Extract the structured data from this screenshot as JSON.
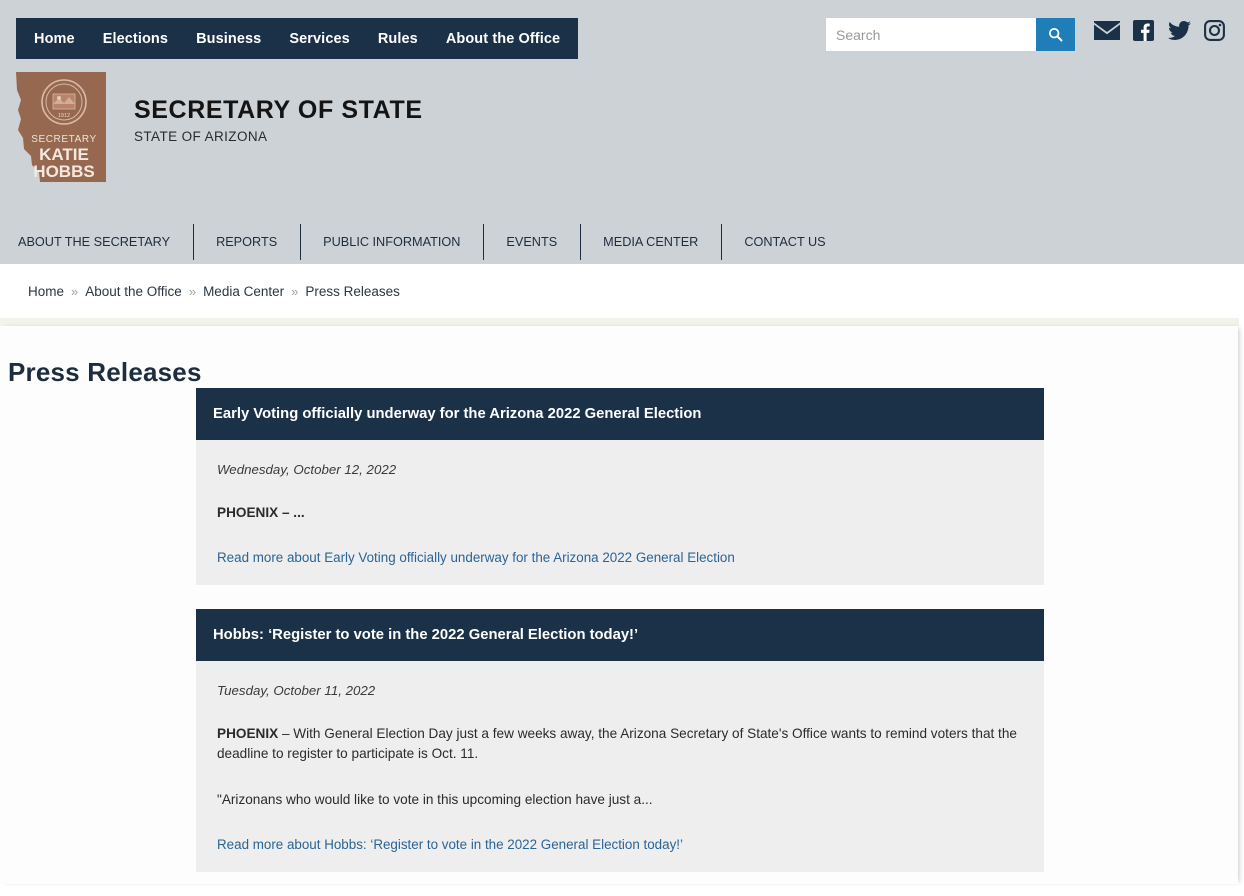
{
  "colors": {
    "navy": "#1a3147",
    "header_gray": "#cdd2d6",
    "accent_blue": "#1f7eb8",
    "link_blue": "#2a6496",
    "card_body_gray": "#eeeeee",
    "cream": "#f3f2eb",
    "logo_brown": "#96684f"
  },
  "main_nav": {
    "items": [
      {
        "label": "Home"
      },
      {
        "label": "Elections"
      },
      {
        "label": "Business"
      },
      {
        "label": "Services"
      },
      {
        "label": "Rules"
      },
      {
        "label": "About the Office"
      }
    ]
  },
  "search": {
    "value": "",
    "placeholder": "Search",
    "button_icon": "search-icon"
  },
  "social": [
    {
      "name": "email-icon",
      "label": "Email"
    },
    {
      "name": "facebook-icon",
      "label": "Facebook"
    },
    {
      "name": "twitter-icon",
      "label": "Twitter"
    },
    {
      "name": "instagram-icon",
      "label": "Instagram"
    }
  ],
  "brand": {
    "title": "SECRETARY OF STATE",
    "subtitle": "STATE OF ARIZONA",
    "seal_text_top": "SECRETARY",
    "seal_name_1": "KATIE",
    "seal_name_2": "HOBBS",
    "seal_year": "1912"
  },
  "sub_nav": {
    "items": [
      {
        "label": "ABOUT THE SECRETARY"
      },
      {
        "label": "REPORTS"
      },
      {
        "label": "PUBLIC INFORMATION"
      },
      {
        "label": "EVENTS"
      },
      {
        "label": "MEDIA CENTER"
      },
      {
        "label": "CONTACT US"
      }
    ]
  },
  "breadcrumb": {
    "separator": "»",
    "items": [
      {
        "label": "Home",
        "current": false
      },
      {
        "label": "About the Office",
        "current": false
      },
      {
        "label": "Media Center",
        "current": false
      },
      {
        "label": "Press Releases",
        "current": true
      }
    ]
  },
  "page": {
    "title": "Press Releases"
  },
  "press_releases": [
    {
      "title": "Early Voting officially underway for the Arizona 2022 General Election",
      "date": "Wednesday, October 12, 2022",
      "lead_bold": "PHOENIX – ...",
      "lead_rest": "",
      "quote": "",
      "read_more": "Read more about Early Voting officially underway for the Arizona 2022 General Election"
    },
    {
      "title": "Hobbs: ‘Register to vote in the 2022 General Election today!’",
      "date": "Tuesday, October 11, 2022",
      "lead_bold": "PHOENIX",
      "lead_rest": " – With General Election Day just a few weeks away, the Arizona Secretary of State's Office wants to remind voters that the deadline to register to participate is Oct. 11.",
      "quote": "\"Arizonans who would like to vote in this upcoming election have just a...",
      "read_more": "Read more about Hobbs: ‘Register to vote in the 2022 General Election today!’"
    }
  ]
}
